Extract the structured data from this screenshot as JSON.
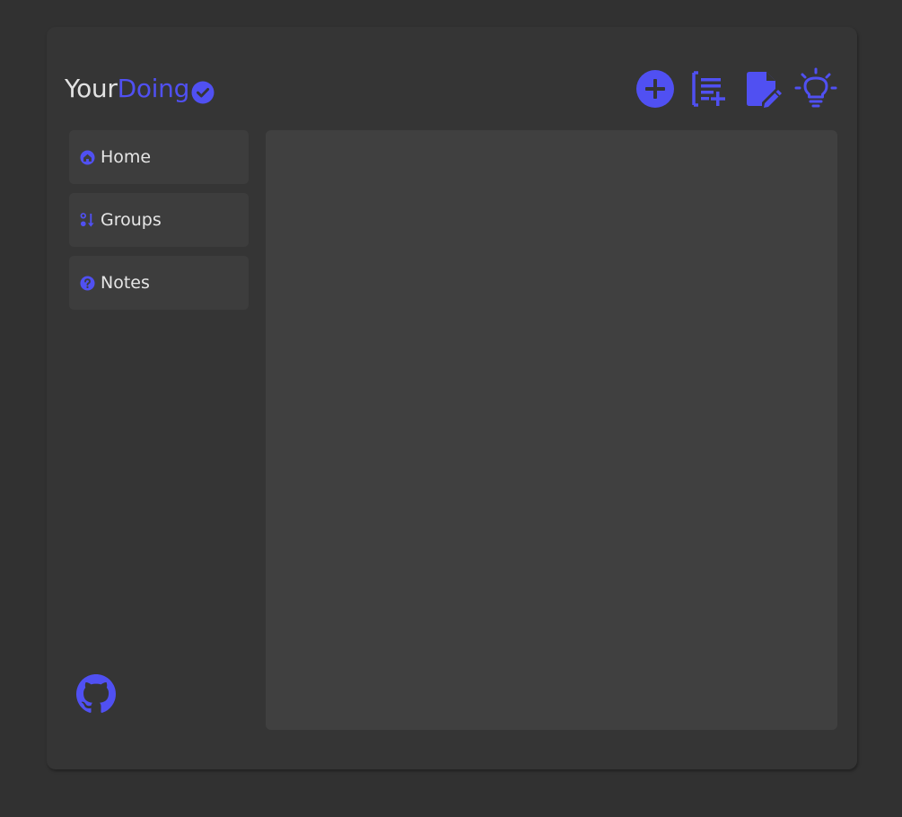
{
  "app": {
    "logo_part1": "Your",
    "logo_part2": "Doing"
  },
  "colors": {
    "accent": "#5050f2",
    "background": "#313131",
    "card": "#353535",
    "panel": "#404040",
    "sidebar_item": "#3d3d3d",
    "text": "#e6e6e6"
  },
  "toolbar": {
    "buttons": [
      {
        "icon": "plus-circle-icon"
      },
      {
        "icon": "add-list-icon"
      },
      {
        "icon": "edit-note-icon"
      },
      {
        "icon": "lightbulb-icon"
      }
    ]
  },
  "sidebar": {
    "items": [
      {
        "label": "Home",
        "icon": "home-icon"
      },
      {
        "label": "Groups",
        "icon": "sort-icon"
      },
      {
        "label": "Notes",
        "icon": "question-icon"
      }
    ],
    "footer_icon": "github-icon"
  }
}
